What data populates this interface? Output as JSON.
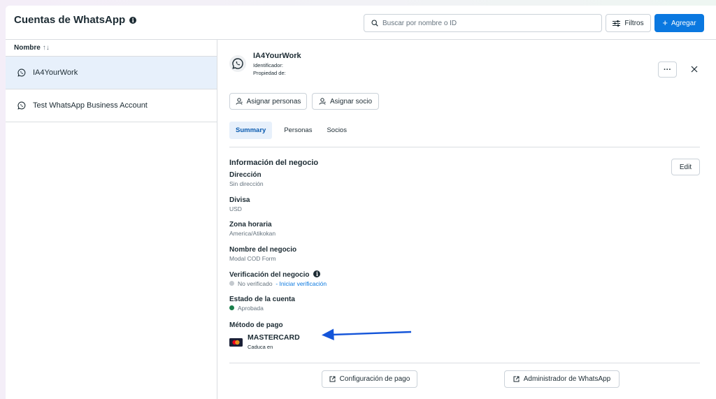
{
  "header": {
    "title": "Cuentas de WhatsApp",
    "info_glyph": "i",
    "search_placeholder": "Buscar por nombre o ID",
    "filter_label": "Filtros",
    "add_label": "Agregar"
  },
  "list": {
    "column_header": "Nombre",
    "sort_glyph": "↑↓",
    "items": [
      {
        "label": "IA4YourWork",
        "selected": true
      },
      {
        "label": "Test WhatsApp Business Account",
        "selected": false
      }
    ]
  },
  "account": {
    "name": "IA4YourWork",
    "id_label": "Identificador:",
    "owner_label": "Propiedad de:",
    "more_glyph": "···",
    "assign_people_label": "Asignar personas",
    "assign_partner_label": "Asignar socio"
  },
  "tabs": [
    {
      "label": "Summary",
      "active": true
    },
    {
      "label": "Personas",
      "active": false
    },
    {
      "label": "Socios",
      "active": false
    }
  ],
  "business_info": {
    "title": "Información del negocio",
    "edit_label": "Edit",
    "fields": {
      "address": {
        "label": "Dirección",
        "value": "Sin dirección"
      },
      "currency": {
        "label": "Divisa",
        "value": "USD"
      },
      "timezone": {
        "label": "Zona horaria",
        "value": "America/Atikokan"
      },
      "business_name": {
        "label": "Nombre del negocio",
        "value": "Modal COD Form"
      },
      "verification": {
        "label": "Verificación del negocio",
        "status": "No verificado",
        "link": "- Iniciar verificación",
        "dot_color": "#c4c9ce"
      },
      "account_status": {
        "label": "Estado de la cuenta",
        "status": "Aprobada",
        "dot_color": "#1b7f4b"
      },
      "payment_method": {
        "label": "Método de pago",
        "card_brand": "MASTERCARD",
        "expiry_label": "Caduca en"
      }
    }
  },
  "footer": {
    "payment_config_label": "Configuración de pago",
    "whatsapp_admin_label": "Administrador de WhatsApp"
  },
  "colors": {
    "accent": "#0a78e0",
    "selected_bg": "#e7f0fb",
    "arrow": "#1455d9",
    "mastercard_red": "#eb001b",
    "mastercard_yellow": "#f79e1b"
  },
  "icons": {
    "search": "search-icon",
    "filter": "sliders-icon",
    "whatsapp": "whatsapp-icon",
    "person": "person-icon",
    "partner": "partner-icon",
    "close": "close-icon",
    "external": "external-link-icon",
    "card": "mastercard-icon",
    "annotation": "arrow-annotation-icon"
  }
}
